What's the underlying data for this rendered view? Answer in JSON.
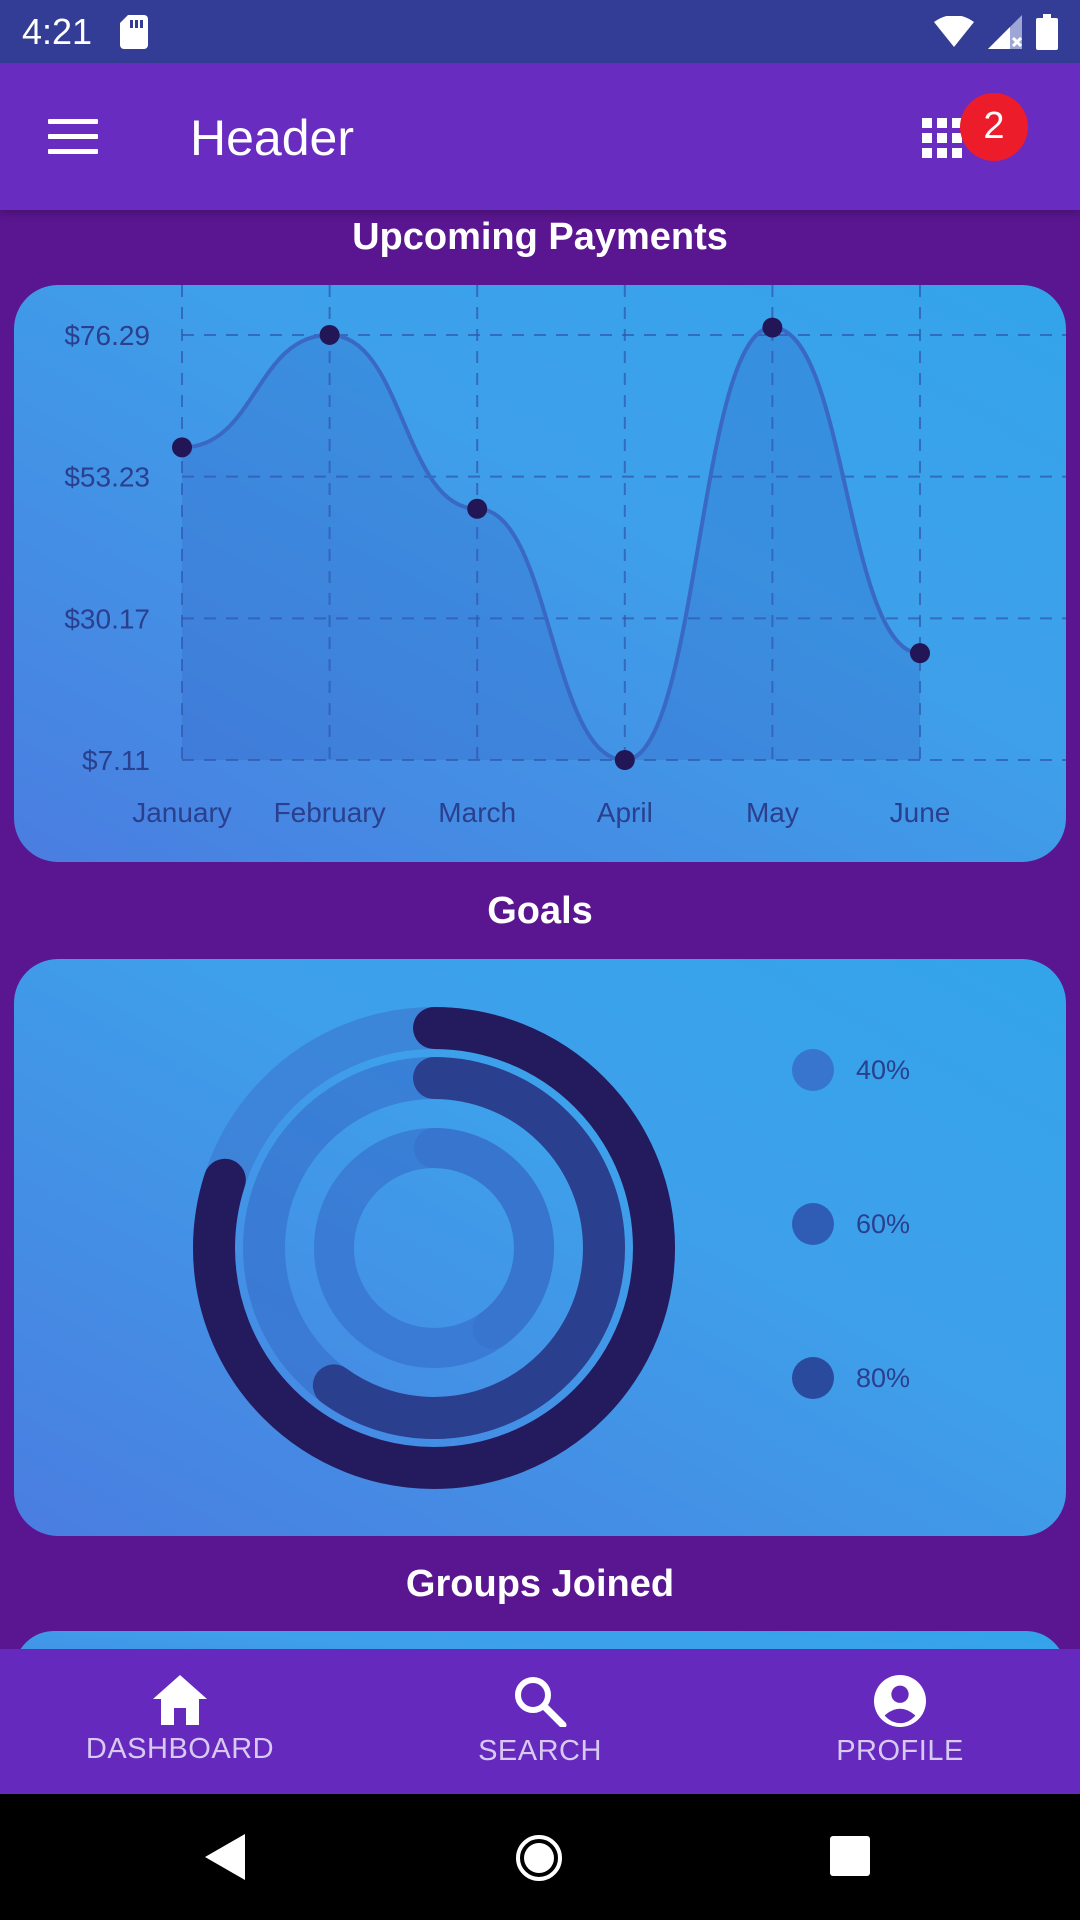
{
  "status_bar": {
    "time": "4:21",
    "icons": [
      "sd-card-icon",
      "wifi-icon",
      "signal-icon",
      "battery-icon"
    ]
  },
  "app_bar": {
    "title": "Header",
    "menu_icon": "hamburger-menu-icon",
    "apps_icon": "grid-apps-icon",
    "badge_count": "2"
  },
  "sections": {
    "payments_title": "Upcoming Payments",
    "goals_title": "Goals",
    "groups_title": "Groups Joined"
  },
  "chart_data": [
    {
      "type": "area",
      "curve": "smooth",
      "categories": [
        "January",
        "February",
        "March",
        "April",
        "May",
        "June"
      ],
      "values": [
        58.0,
        76.3,
        48.0,
        7.11,
        77.5,
        24.5
      ],
      "y_ticks": [
        "$7.11",
        "$30.17",
        "$53.23",
        "$76.29"
      ],
      "ylim": [
        7.11,
        76.29
      ],
      "grid": true,
      "grid_style": "dashed"
    },
    {
      "type": "radial-progress",
      "series": [
        {
          "name": "40%",
          "value": 40
        },
        {
          "name": "60%",
          "value": 60
        },
        {
          "name": "80%",
          "value": 80
        }
      ],
      "legend_position": "right"
    }
  ],
  "colors": {
    "status_bar": "#343d96",
    "app_bar": "#692cc0",
    "background": "#5a1690",
    "badge": "#ec1c2a",
    "chart_line": "#3a69c4",
    "chart_point": "#221656",
    "ring_40": "#3775cf",
    "ring_60": "#2f5db6",
    "ring_80": "#241a5e",
    "track": "#3c7fd6",
    "axis_text": "#2a3f8d"
  },
  "bottom_nav": {
    "items": [
      {
        "label": "DASHBOARD",
        "icon": "home-icon"
      },
      {
        "label": "SEARCH",
        "icon": "search-icon"
      },
      {
        "label": "PROFILE",
        "icon": "account-circle-icon"
      }
    ]
  },
  "system_nav": {
    "icons": [
      "back-icon",
      "home-circle-icon",
      "recents-icon"
    ]
  }
}
